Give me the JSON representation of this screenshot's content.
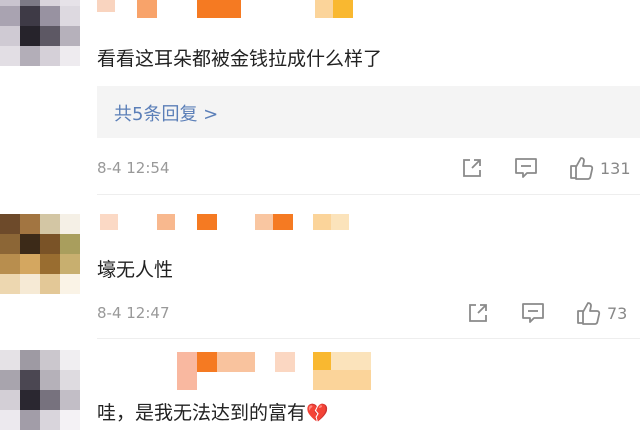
{
  "comments": [
    {
      "text": "看看这耳朵都被金钱拉成什么样了",
      "replies_label": "共5条回复 >",
      "time": "8-4 12:54",
      "likes": "131",
      "icons": [
        "share-icon",
        "reply-icon",
        "thumbs-up-icon"
      ]
    },
    {
      "text": "壕无人性",
      "time": "8-4 12:47",
      "likes": "73",
      "icons": [
        "share-icon",
        "reply-icon",
        "thumbs-up-icon"
      ]
    },
    {
      "text": "哇，是我无法达到的富有",
      "emoji": "💔",
      "icons": []
    }
  ],
  "colors": {
    "link": "#5b7fb8",
    "meta_text": "#999999",
    "replies_bg": "#f4f4f4",
    "name_mosaic_orange": "#f57a22"
  }
}
